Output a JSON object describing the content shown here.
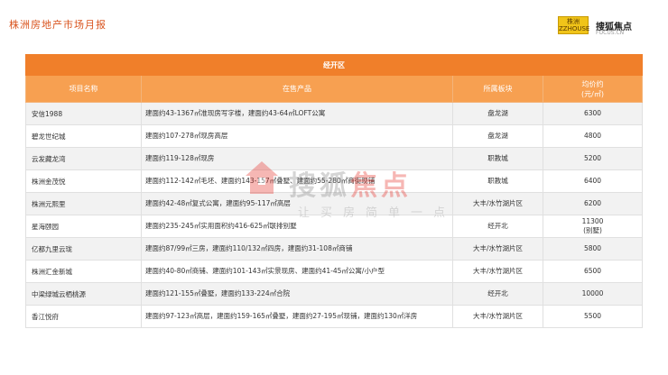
{
  "header": {
    "title": "株洲房地产市场月报",
    "logo_left_line1": "株洲",
    "logo_left_line2": "ZZHOUSE",
    "logo_right": "搜狐焦点",
    "logo_right_sub": "FOCUS.CN"
  },
  "table": {
    "district": "经开区",
    "columns": {
      "name": "项目名称",
      "product": "在售产品",
      "area": "所属板块",
      "price": "均价约\n(元/㎡)"
    },
    "rows": [
      {
        "name": "安信1988",
        "product": "建面约43-1367㎡准现房写字楼，建面约43-64㎡LOFT公寓",
        "area": "盘龙湖",
        "price": "6300"
      },
      {
        "name": "碧龙世纪城",
        "product": "建面约107-278㎡现房高层",
        "area": "盘龙湖",
        "price": "4800"
      },
      {
        "name": "云发藏龙湾",
        "product": "建面约119-128㎡现房",
        "area": "职教城",
        "price": "5200"
      },
      {
        "name": "株洲金茂悦",
        "product": "建面约112-142㎡毛坯、建面约143-157㎡叠墅、建面约55-280㎡商街现铺",
        "area": "职教城",
        "price": "6400"
      },
      {
        "name": "株洲元熙里",
        "product": "建面约42-48㎡复式公寓，建面约95-117㎡高层",
        "area": "大丰/水竹湖片区",
        "price": "6200"
      },
      {
        "name": "星海颐园",
        "product": "建面约235-245㎡实用面积约416-625㎡联排别墅",
        "area": "经开北",
        "price": "11300\n(别墅)"
      },
      {
        "name": "亿都九里云珑",
        "product": "建面约87/99㎡三房，建面约110/132㎡四房，建面约31-108㎡商铺",
        "area": "大丰/水竹湖片区",
        "price": "5800"
      },
      {
        "name": "株洲汇金新城",
        "product": "建面约40-80㎡商铺、建面约101-143㎡实景现房、建面约41-45㎡公寓/小户型",
        "area": "大丰/水竹湖片区",
        "price": "6500"
      },
      {
        "name": "中梁绿城云栖桃源",
        "product": "建面约121-155㎡叠墅，建面约133-224㎡合院",
        "area": "经开北",
        "price": "10000"
      },
      {
        "name": "香江悦府",
        "product": "建面约97-123㎡高层，建面约159-165㎡叠墅，建面约27-195㎡现铺，建面约130㎡洋房",
        "area": "大丰/水竹湖片区",
        "price": "5500"
      }
    ]
  },
  "watermark": {
    "brand_gray": "搜狐",
    "brand_red": "焦点",
    "slogan": "让买房简单一点"
  },
  "colors": {
    "title": "#d9541e",
    "district_bg": "#f07f2a",
    "header_bg": "#f7a051",
    "row_alt": "#f2f2f2"
  }
}
